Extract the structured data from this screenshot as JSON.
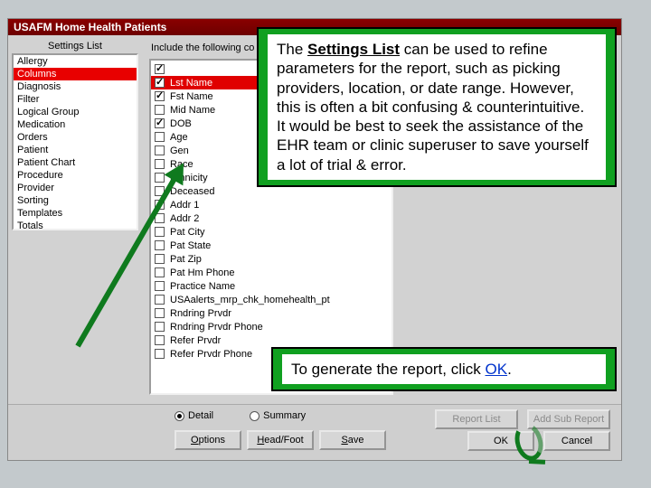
{
  "title": "USAFM Home Health Patients",
  "labels": {
    "settings_list": "Settings List",
    "include_prefix": "Include the following co"
  },
  "settings": [
    "Allergy",
    "Columns",
    "Diagnosis",
    "Filter",
    "Logical Group",
    "Medication",
    "Orders",
    "Patient",
    "Patient Chart",
    "Procedure",
    "Provider",
    "Sorting",
    "Templates",
    "Totals"
  ],
  "columns": [
    {
      "on": true,
      "label": " ",
      "sel": false
    },
    {
      "on": true,
      "label": "Lst Name",
      "sel": true
    },
    {
      "on": true,
      "label": "Fst Name",
      "sel": false
    },
    {
      "on": false,
      "label": "Mid Name",
      "sel": false
    },
    {
      "on": true,
      "label": "DOB",
      "sel": false
    },
    {
      "on": false,
      "label": "Age",
      "sel": false
    },
    {
      "on": false,
      "label": "Gen",
      "sel": false
    },
    {
      "on": false,
      "label": "Race",
      "sel": false
    },
    {
      "on": false,
      "label": "Ethnicity",
      "sel": false
    },
    {
      "on": false,
      "label": "Deceased",
      "sel": false
    },
    {
      "on": false,
      "label": "Addr 1",
      "sel": false
    },
    {
      "on": false,
      "label": "Addr 2",
      "sel": false
    },
    {
      "on": false,
      "label": "Pat City",
      "sel": false
    },
    {
      "on": false,
      "label": "Pat State",
      "sel": false
    },
    {
      "on": false,
      "label": "Pat Zip",
      "sel": false
    },
    {
      "on": false,
      "label": "Pat Hm Phone",
      "sel": false
    },
    {
      "on": false,
      "label": "Practice Name",
      "sel": false
    },
    {
      "on": false,
      "label": "USAalerts_mrp_chk_homehealth_pt",
      "sel": false
    },
    {
      "on": false,
      "label": "Rndring Prvdr",
      "sel": false
    },
    {
      "on": false,
      "label": "Rndring Prvdr Phone",
      "sel": false
    },
    {
      "on": false,
      "label": "Refer Prvdr",
      "sel": false
    },
    {
      "on": false,
      "label": "Refer Prvdr Phone",
      "sel": false
    }
  ],
  "radios": {
    "detail": "Detail",
    "summary": "Summary"
  },
  "buttons": {
    "options": "Options",
    "head_foot": "Head/Foot",
    "save": "Save",
    "report_list": "Report List",
    "add_sub": "Add Sub Report",
    "ok": "OK",
    "cancel": "Cancel"
  },
  "annotations": {
    "callout1_a": "The ",
    "callout1_b": "Settings List",
    "callout1_c": " can be used to refine parameters for the report, such as picking providers, location, or date range.  However, this is often a bit confusing & counterintuitive.  It would be best to seek the assistance of the EHR team or clinic superuser to save yourself a lot of trial & error.",
    "callout2_a": "To generate the report, click ",
    "callout2_b": "OK",
    "callout2_c": "."
  }
}
